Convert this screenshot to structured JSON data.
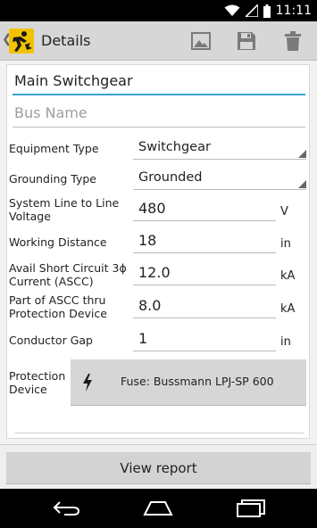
{
  "status_bar": {
    "time": "11:11"
  },
  "action_bar": {
    "title": "Details",
    "icons": [
      "app-logo-icon",
      "image-icon",
      "save-icon",
      "delete-icon"
    ]
  },
  "form": {
    "name_value": "Main Switchgear",
    "bus_placeholder": "Bus Name",
    "equipment_type": {
      "label": "Equipment Type",
      "value": "Switchgear"
    },
    "grounding_type": {
      "label": "Grounding Type",
      "value": "Grounded"
    },
    "system_voltage": {
      "label_line1": "System Line to Line",
      "label_line2": "Voltage",
      "value": "480",
      "unit": "V"
    },
    "working_distance": {
      "label": "Working Distance",
      "value": "18",
      "unit": "in"
    },
    "avail_short_circuit": {
      "label_line1": "Avail Short Circuit 3ϕ",
      "label_line2": "Current (ASCC)",
      "value": "12.0",
      "unit": "kA"
    },
    "part_ascc": {
      "label_line1": "Part of ASCC thru",
      "label_line2": "Protection Device",
      "value": "8.0",
      "unit": "kA"
    },
    "conductor_gap": {
      "label": "Conductor Gap",
      "value": "1",
      "unit": "in"
    },
    "protection_device": {
      "label_line1": "Protection",
      "label_line2": "Device",
      "value": "Fuse: Bussmann LPJ-SP 600"
    }
  },
  "footer": {
    "view_report_label": "View report"
  },
  "colors": {
    "accent": "#3aa3cf",
    "action_bar": "#d7d7d7",
    "logo_yellow": "#f2c200"
  }
}
